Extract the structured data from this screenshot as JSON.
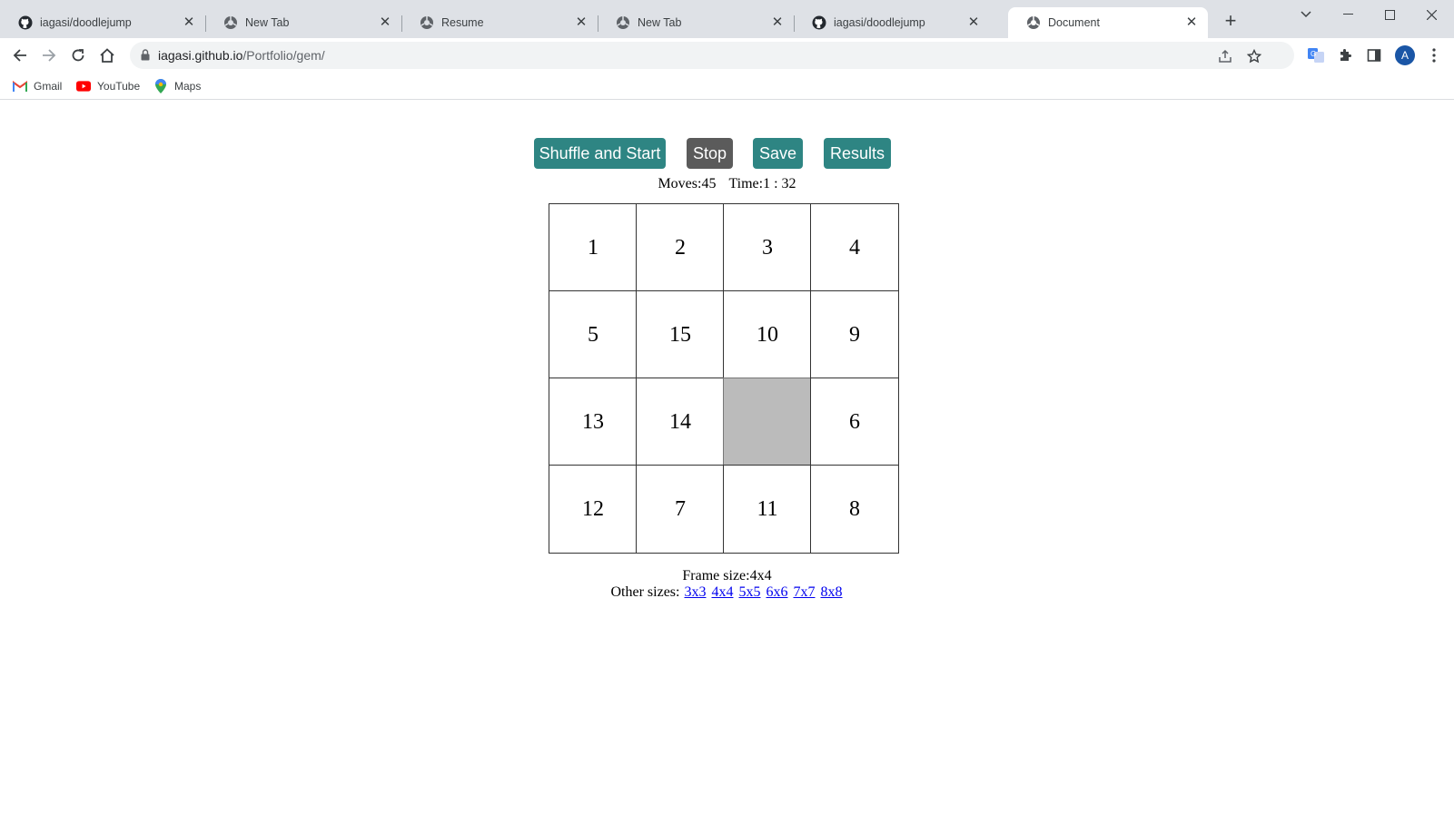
{
  "browser": {
    "tabs": [
      {
        "title": "iagasi/doodlejump",
        "icon": "github-icon"
      },
      {
        "title": "New Tab",
        "icon": "globe-icon"
      },
      {
        "title": "Resume",
        "icon": "globe-icon"
      },
      {
        "title": "New Tab",
        "icon": "globe-icon"
      },
      {
        "title": "iagasi/doodlejump",
        "icon": "github-icon"
      },
      {
        "title": "Document",
        "icon": "globe-icon",
        "active": true
      }
    ],
    "url_host": "iagasi.github.io",
    "url_path": "/Portfolio/gem/",
    "profile_initial": "A",
    "bookmarks": [
      {
        "label": "Gmail",
        "icon": "gmail-icon"
      },
      {
        "label": "YouTube",
        "icon": "youtube-icon"
      },
      {
        "label": "Maps",
        "icon": "maps-icon"
      }
    ]
  },
  "game": {
    "buttons": {
      "shuffle": "Shuffle and Start",
      "stop": "Stop",
      "save": "Save",
      "results": "Results"
    },
    "moves_label": "Moves:45",
    "time_label": "Time:1 : 32",
    "board": [
      [
        "1",
        "2",
        "3",
        "4"
      ],
      [
        "5",
        "15",
        "10",
        "9"
      ],
      [
        "13",
        "14",
        "",
        "6"
      ],
      [
        "12",
        "7",
        "11",
        "8"
      ]
    ],
    "frame_size_label": "Frame size:4x4",
    "other_sizes_label": "Other sizes:",
    "size_links": [
      "3x3",
      "4x4",
      "5x5",
      "6x6",
      "7x7",
      "8x8"
    ]
  },
  "colors": {
    "teal_button": "#2e8583",
    "gray_button": "#5b5b5b",
    "empty_cell": "#bbbbbb",
    "link": "#0000ee"
  }
}
